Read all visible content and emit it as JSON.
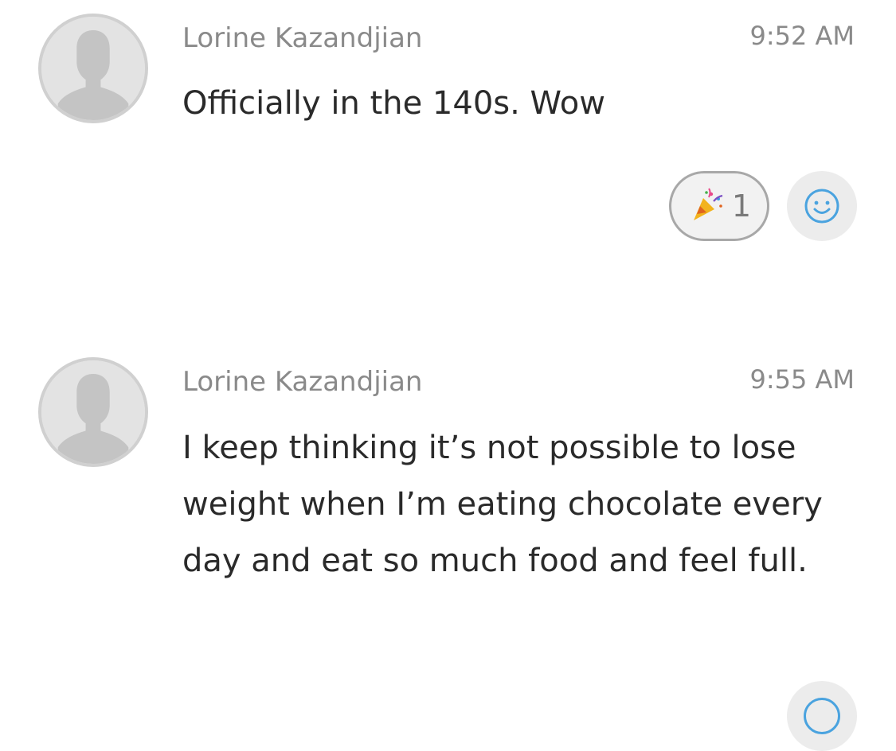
{
  "messages": [
    {
      "sender": "Lorine Kazandjian",
      "time": "9:52 AM",
      "text": "Officially in the 140s. Wow",
      "reactions": [
        {
          "emoji": "party-popper-icon",
          "count": "1"
        }
      ]
    },
    {
      "sender": "Lorine Kazandjian",
      "time": "9:55 AM",
      "text": "I keep thinking it’s not possible to lose weight when I’m eating chocolate every day and eat so much food and feel full."
    }
  ],
  "icons": {
    "avatar": "default-user-silhouette-icon",
    "add_reaction": "smiley-face-icon"
  },
  "colors": {
    "text_primary": "#2a2a2a",
    "text_secondary": "#8a8a8a",
    "avatar_bg": "#e3e3e3",
    "accent": "#4aa3df"
  }
}
